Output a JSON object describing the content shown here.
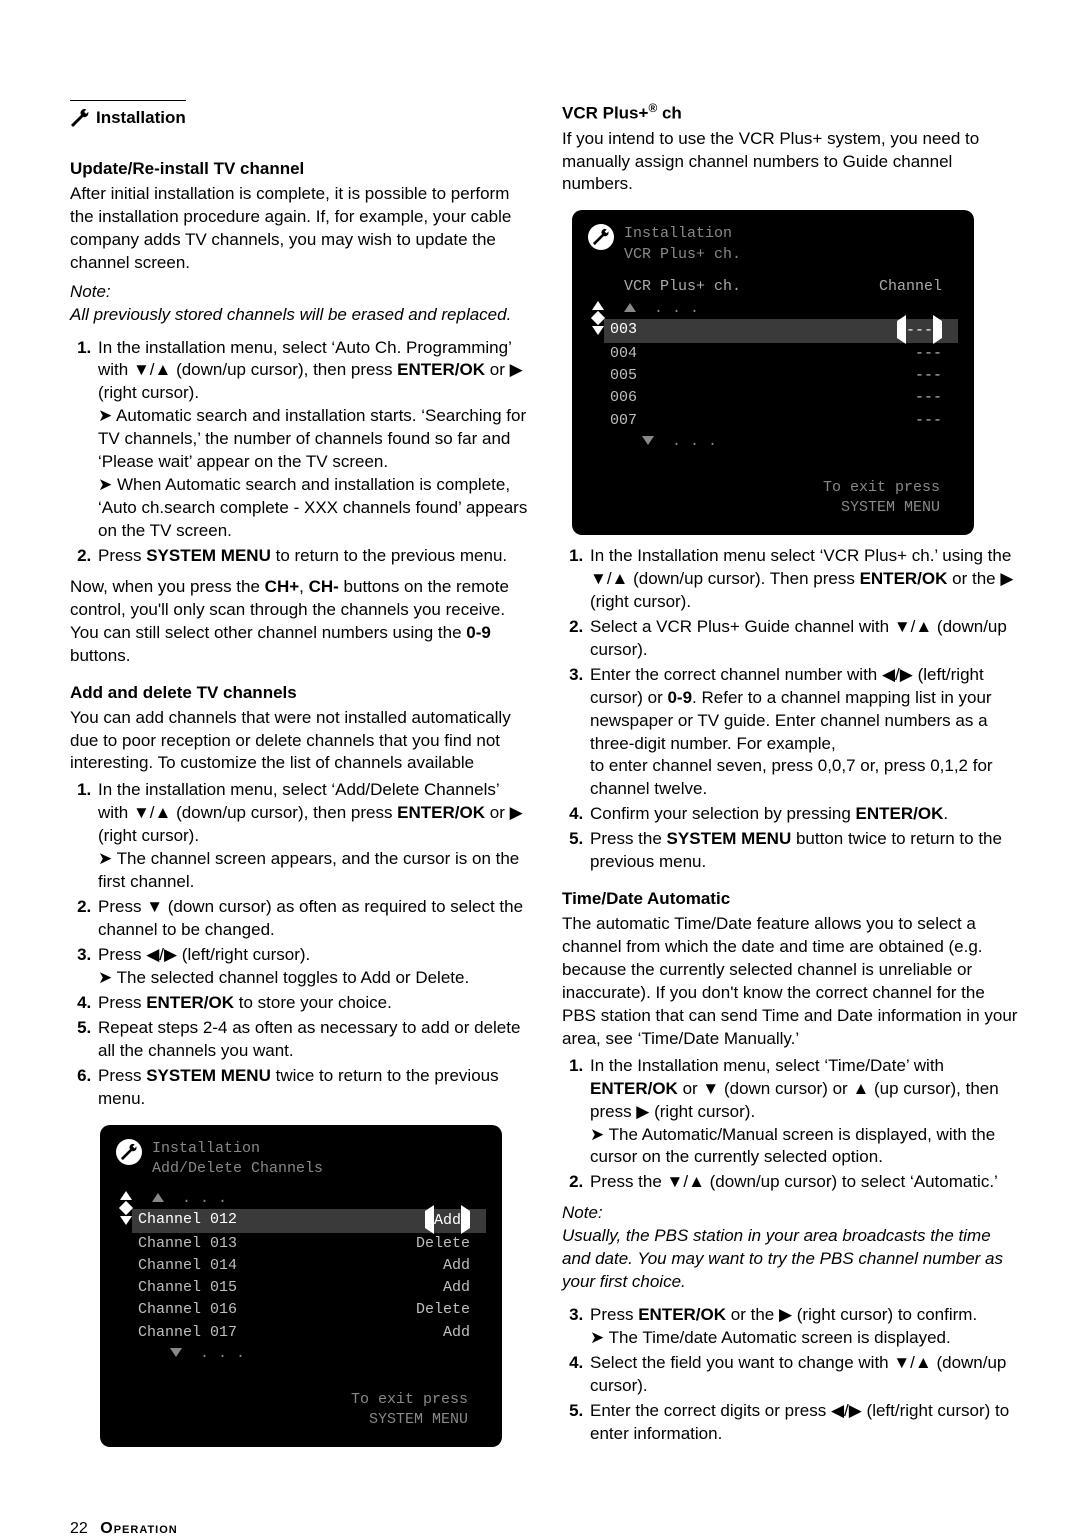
{
  "left": {
    "section_title": "Installation",
    "s1": {
      "heading": "Update/Re-install TV channel",
      "intro": "After initial installation is complete, it is possible to perform the installation procedure again. If, for example, your cable company adds TV channels, you may wish to update the channel screen.",
      "note_label": "Note:",
      "note": "All previously stored channels will be erased and replaced.",
      "step1a": "In the installation menu, select ‘Auto Ch. Programming’ with ",
      "step1b": " (down/up cursor), then press ",
      "step1c": " or ",
      "step1d": " (right cursor).",
      "enterok": "ENTER/OK",
      "res1": "Automatic search and installation starts. ‘Searching for TV channels,’ the number of channels found so far and ‘Please wait’ appear on the TV screen.",
      "res2": "When Automatic search and installation is complete, ‘Auto ch.search complete - XXX channels found’ appears on the TV screen.",
      "step2a": "Press ",
      "sysmenu": "SYSTEM MENU",
      "step2b": " to return to the previous menu.",
      "outro_a": "Now, when you press the ",
      "chplus": "CH+",
      "outro_b": ", ",
      "chminus": "CH-",
      "outro_c": " buttons on the remote control, you'll only scan through the channels you receive. You can still select other channel numbers using the ",
      "zn": "0-9",
      "outro_d": " buttons."
    },
    "s2": {
      "heading": "Add and delete TV channels",
      "intro": "You can add channels that were not installed automatically due to poor reception or delete channels that you find not interesting. To customize the list of channels available",
      "step1a": "In the installation menu, select ‘Add/Delete Channels’ with ",
      "step1b": " (down/up cursor), then press ",
      "step1c": " or ",
      "step1d": " (right cursor).",
      "res1": "The channel screen appears, and the cursor is on the first channel.",
      "step2a": "Press ",
      "step2b": " (down cursor) as often as required to select the channel to be changed.",
      "step3a": "Press ",
      "step3b": " (left/right cursor).",
      "res3": "The selected channel toggles to Add or Delete.",
      "step4a": "Press ",
      "step4b": " to store your choice.",
      "step5": "Repeat steps 2-4 as often as necessary to add or delete all the channels you want.",
      "step6a": "Press ",
      "step6b": " twice to return to the previous menu."
    },
    "osd1": {
      "title1": "Installation",
      "title2": "Add/Delete Channels",
      "rows": [
        {
          "l": "Channel 012",
          "r": "Add",
          "sel": true,
          "arrows": true
        },
        {
          "l": "Channel 013",
          "r": "Delete"
        },
        {
          "l": "Channel 014",
          "r": "Add"
        },
        {
          "l": "Channel 015",
          "r": "Add"
        },
        {
          "l": "Channel 016",
          "r": "Delete"
        },
        {
          "l": "Channel 017",
          "r": "Add"
        }
      ],
      "foot1": "To exit press",
      "foot2": "SYSTEM MENU"
    }
  },
  "right": {
    "s3": {
      "heading_pre": "VCR Plus+",
      "heading_post": " ch",
      "intro": "If you intend to use the VCR Plus+ system, you need to manually assign channel numbers to Guide channel numbers.",
      "step1a": "In the Installation menu select ‘VCR Plus+ ch.’ using the ",
      "step1b": " (down/up cursor). Then press ",
      "step1c": " or the ",
      "step1d": " (right cursor).",
      "step2a": "Select a VCR Plus+ Guide channel with ",
      "step2b": " (down/up cursor).",
      "step3a": "Enter the correct channel number with ",
      "step3b": " (left/right cursor) or ",
      "step3c": ". Refer to a channel mapping list in your newspaper or TV guide. Enter channel numbers as a three-digit number. For example,",
      "step3d": "to enter channel seven, press 0,0,7 or, press 0,1,2 for channel twelve.",
      "step4a": "Confirm your selection by pressing ",
      "step4b": ".",
      "step5a": "Press the ",
      "step5b": " button twice to return to the previous menu."
    },
    "osd2": {
      "title1": "Installation",
      "title2": "VCR Plus+ ch.",
      "head_l": "VCR Plus+ ch.",
      "head_r": "Channel",
      "rows": [
        {
          "l": "003",
          "r": "---",
          "sel": true,
          "arrows": true
        },
        {
          "l": "004",
          "r": "---"
        },
        {
          "l": "005",
          "r": "---"
        },
        {
          "l": "006",
          "r": "---"
        },
        {
          "l": "007",
          "r": "---"
        }
      ],
      "foot1": "To exit press",
      "foot2": "SYSTEM MENU"
    },
    "s4": {
      "heading": "Time/Date Automatic",
      "intro": "The automatic Time/Date feature allows you to select a channel from which the date and time are obtained (e.g. because the currently selected channel is unreliable or inaccurate). If you don't know the correct channel for the PBS station that can send Time and Date information in your area, see ‘Time/Date Manually.’",
      "step1a": "In the Installation menu, select ‘Time/Date’ with ",
      "step1b": " or ",
      "step1c": " (down cursor) or ",
      "step1d": " (up cursor), then press ",
      "step1e": " (right cursor).",
      "res1": "The Automatic/Manual screen is displayed, with the cursor on the currently selected option.",
      "step2a": "Press the ",
      "step2b": " (down/up cursor) to select ‘Automatic.’",
      "note_label": "Note:",
      "note": "Usually, the PBS station in your area broadcasts the time and date. You may want to try the PBS channel number as your first choice.",
      "step3a": "Press ",
      "step3b": " or the ",
      "step3c": " (right cursor) to confirm.",
      "res3": "The Time/date Automatic screen is displayed.",
      "step4a": "Select the field you want to change with ",
      "step4b": " (down/up cursor).",
      "step5a": "Enter the correct digits or press ",
      "step5b": " (left/right cursor) to enter information."
    }
  },
  "shared": {
    "enterok": "ENTER/OK",
    "sysmenu": "SYSTEM MENU",
    "zn": "0-9"
  },
  "footer": {
    "page": "22",
    "section": "Operation"
  }
}
